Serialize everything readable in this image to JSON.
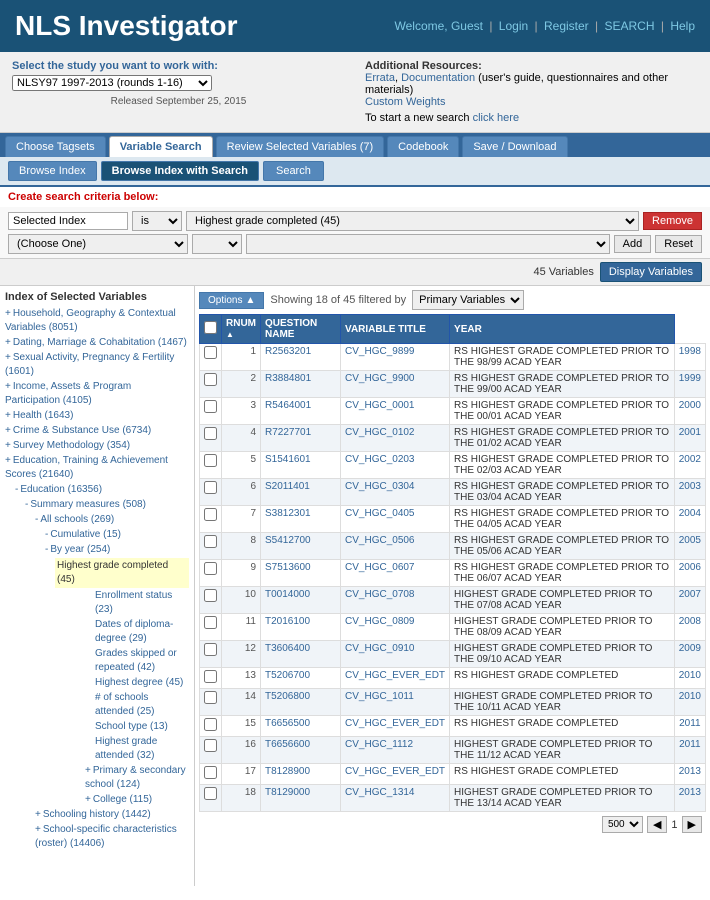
{
  "header": {
    "title": "NLS Investigator",
    "welcome": "Welcome, Guest",
    "links": [
      "Login",
      "Register",
      "SEARCH",
      "Help"
    ]
  },
  "study": {
    "label": "Select the study you want to work with:",
    "selected": "NLSY97 1997-2013 (rounds 1-16)",
    "released": "Released September 25, 2015"
  },
  "additional": {
    "title": "Additional Resources:",
    "links": [
      "Errata",
      "Documentation",
      "Custom Weights"
    ],
    "description": "(user's guide, questionnaires and other materials)",
    "new_search_text": "To start a new search click here"
  },
  "nav_tabs": [
    "Choose Tagsets",
    "Variable Search",
    "Review Selected Variables (7)",
    "Codebook",
    "Save / Download"
  ],
  "active_nav_tab": "Variable Search",
  "sub_tabs": [
    "Browse Index",
    "Browse Index with Search",
    "Search"
  ],
  "active_sub_tab": "Browse Index with Search",
  "create_search_label": "Create search criteria below:",
  "filter": {
    "field_label": "Selected Index",
    "operator": "is",
    "value": "Highest grade completed (45)",
    "remove_label": "Remove",
    "add_label": "Add",
    "reset_label": "Reset",
    "choose_one": "(Choose One)"
  },
  "vars": {
    "count_text": "45 Variables",
    "display_btn": "Display Variables"
  },
  "index": {
    "title": "Index of Selected Variables",
    "items": [
      {
        "label": "Household, Geography & Contextual Variables (8051)",
        "indent": 0,
        "type": "plus"
      },
      {
        "label": "Dating, Marriage & Cohabitation (1467)",
        "indent": 0,
        "type": "plus"
      },
      {
        "label": "Sexual Activity, Pregnancy & Fertility (1601)",
        "indent": 0,
        "type": "plus"
      },
      {
        "label": "Income, Assets & Program Participation (4105)",
        "indent": 0,
        "type": "plus"
      },
      {
        "label": "Health (1643)",
        "indent": 0,
        "type": "plus"
      },
      {
        "label": "Crime & Substance Use (6734)",
        "indent": 0,
        "type": "plus"
      },
      {
        "label": "Survey Methodology (354)",
        "indent": 0,
        "type": "plus"
      },
      {
        "label": "Education, Training & Achievement Scores (21640)",
        "indent": 0,
        "type": "plus"
      },
      {
        "label": "Education (16356)",
        "indent": 1,
        "type": "minus"
      },
      {
        "label": "Summary measures (508)",
        "indent": 2,
        "type": "minus"
      },
      {
        "label": "All schools (269)",
        "indent": 3,
        "type": "minus"
      },
      {
        "label": "Cumulative (15)",
        "indent": 4,
        "type": "minus"
      },
      {
        "label": "By year (254)",
        "indent": 4,
        "type": "minus"
      },
      {
        "label": "Highest grade completed (45)",
        "indent": 5,
        "type": "highlight"
      },
      {
        "label": "Enrollment status (23)",
        "indent": 5,
        "type": "link"
      },
      {
        "label": "Dates of diploma-degree (29)",
        "indent": 5,
        "type": "link"
      },
      {
        "label": "Grades skipped or repeated (42)",
        "indent": 5,
        "type": "link"
      },
      {
        "label": "Highest degree (45)",
        "indent": 5,
        "type": "link"
      },
      {
        "label": "# of schools attended (25)",
        "indent": 5,
        "type": "link"
      },
      {
        "label": "School type (13)",
        "indent": 5,
        "type": "link"
      },
      {
        "label": "Highest grade attended (32)",
        "indent": 5,
        "type": "link"
      },
      {
        "label": "Primary & secondary school (124)",
        "indent": 4,
        "type": "plus"
      },
      {
        "label": "College (115)",
        "indent": 4,
        "type": "plus"
      },
      {
        "label": "Schooling history (1442)",
        "indent": 3,
        "type": "plus"
      },
      {
        "label": "School-specific characteristics (roster) (14406)",
        "indent": 3,
        "type": "plus"
      }
    ]
  },
  "showing": {
    "text": "Showing 18 of 45 filtered by",
    "filter_type": "Primary Variables",
    "options_btn": "Options"
  },
  "table": {
    "columns": [
      "",
      "RNUM",
      "QUESTION NAME",
      "VARIABLE TITLE",
      "YEAR"
    ],
    "rows": [
      {
        "num": 1,
        "rnum": "R2563201",
        "qname": "CV_HGC_9899",
        "title": "RS HIGHEST GRADE COMPLETED PRIOR TO THE 98/99 ACAD YEAR",
        "year": 1998
      },
      {
        "num": 2,
        "rnum": "R3884801",
        "qname": "CV_HGC_9900",
        "title": "RS HIGHEST GRADE COMPLETED PRIOR TO THE 99/00 ACAD YEAR",
        "year": 1999
      },
      {
        "num": 3,
        "rnum": "R5464001",
        "qname": "CV_HGC_0001",
        "title": "RS HIGHEST GRADE COMPLETED PRIOR TO THE 00/01 ACAD YEAR",
        "year": 2000
      },
      {
        "num": 4,
        "rnum": "R7227701",
        "qname": "CV_HGC_0102",
        "title": "RS HIGHEST GRADE COMPLETED PRIOR TO THE 01/02 ACAD YEAR",
        "year": 2001
      },
      {
        "num": 5,
        "rnum": "S1541601",
        "qname": "CV_HGC_0203",
        "title": "RS HIGHEST GRADE COMPLETED PRIOR TO THE 02/03 ACAD YEAR",
        "year": 2002
      },
      {
        "num": 6,
        "rnum": "S2011401",
        "qname": "CV_HGC_0304",
        "title": "RS HIGHEST GRADE COMPLETED PRIOR TO THE 03/04 ACAD YEAR",
        "year": 2003
      },
      {
        "num": 7,
        "rnum": "S3812301",
        "qname": "CV_HGC_0405",
        "title": "RS HIGHEST GRADE COMPLETED PRIOR TO THE 04/05 ACAD YEAR",
        "year": 2004
      },
      {
        "num": 8,
        "rnum": "S5412700",
        "qname": "CV_HGC_0506",
        "title": "RS HIGHEST GRADE COMPLETED PRIOR TO THE 05/06 ACAD YEAR",
        "year": 2005
      },
      {
        "num": 9,
        "rnum": "S7513600",
        "qname": "CV_HGC_0607",
        "title": "RS HIGHEST GRADE COMPLETED PRIOR TO THE 06/07 ACAD YEAR",
        "year": 2006
      },
      {
        "num": 10,
        "rnum": "T0014000",
        "qname": "CV_HGC_0708",
        "title": "HIGHEST GRADE COMPLETED PRIOR TO THE 07/08 ACAD YEAR",
        "year": 2007
      },
      {
        "num": 11,
        "rnum": "T2016100",
        "qname": "CV_HGC_0809",
        "title": "HIGHEST GRADE COMPLETED PRIOR TO THE 08/09 ACAD YEAR",
        "year": 2008
      },
      {
        "num": 12,
        "rnum": "T3606400",
        "qname": "CV_HGC_0910",
        "title": "HIGHEST GRADE COMPLETED PRIOR TO THE 09/10 ACAD YEAR",
        "year": 2009
      },
      {
        "num": 13,
        "rnum": "T5206700",
        "qname": "CV_HGC_EVER_EDT",
        "title": "RS HIGHEST GRADE COMPLETED",
        "year": 2010
      },
      {
        "num": 14,
        "rnum": "T5206800",
        "qname": "CV_HGC_1011",
        "title": "HIGHEST GRADE COMPLETED PRIOR TO THE 10/11 ACAD YEAR",
        "year": 2010
      },
      {
        "num": 15,
        "rnum": "T6656500",
        "qname": "CV_HGC_EVER_EDT",
        "title": "RS HIGHEST GRADE COMPLETED",
        "year": 2011
      },
      {
        "num": 16,
        "rnum": "T6656600",
        "qname": "CV_HGC_1112",
        "title": "HIGHEST GRADE COMPLETED PRIOR TO THE 11/12 ACAD YEAR",
        "year": 2011
      },
      {
        "num": 17,
        "rnum": "T8128900",
        "qname": "CV_HGC_EVER_EDT",
        "title": "RS HIGHEST GRADE COMPLETED",
        "year": 2013
      },
      {
        "num": 18,
        "rnum": "T8129000",
        "qname": "CV_HGC_1314",
        "title": "HIGHEST GRADE COMPLETED PRIOR TO THE 13/14 ACAD YEAR",
        "year": 2013
      }
    ]
  },
  "pagination": {
    "page_size": "500",
    "current_page": "1"
  }
}
